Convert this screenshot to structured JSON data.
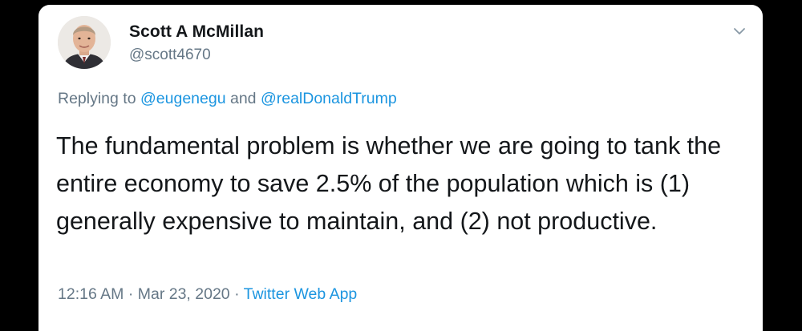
{
  "tweet": {
    "author_name": "Scott A McMillan",
    "author_handle": "@scott4670",
    "reply_prefix": "Replying to",
    "reply_user_1": "@eugenegu",
    "reply_joiner": "and",
    "reply_user_2": "@realDonaldTrump",
    "text": "The fundamental problem is whether we are going to tank the entire economy to save 2.5% of the population which is (1) generally expensive to maintain, and (2) not productive.",
    "time": "12:16 AM",
    "separator": "·",
    "date": "Mar 23, 2020",
    "source": "Twitter Web App"
  },
  "icons": {
    "menu": "chevron-down-icon",
    "avatar": "profile-photo"
  },
  "colors": {
    "background": "#000000",
    "card": "#ffffff",
    "text_primary": "#14171a",
    "text_secondary": "#657786",
    "link": "#1b95e0"
  }
}
